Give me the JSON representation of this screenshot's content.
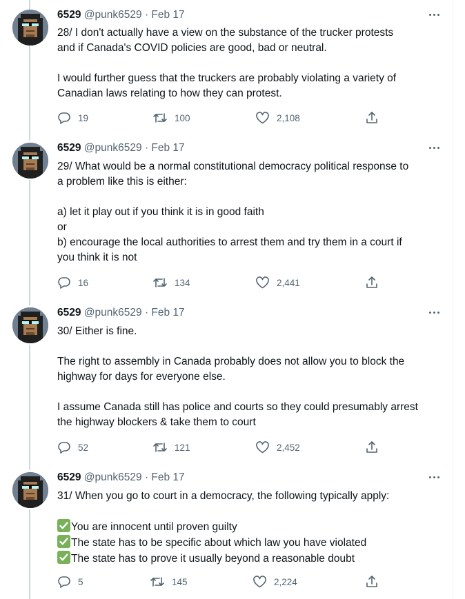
{
  "tweets": [
    {
      "author": "6529",
      "handle": "@punk6529",
      "separator": "·",
      "date": "Feb 17",
      "paragraphs": [
        [
          "28/ I don't actually have a view on the substance of the trucker protests",
          "and if Canada's COVID policies are good, bad or neutral."
        ],
        [
          "I would further guess that the truckers are probably violating a variety of",
          "Canadian laws relating to how they can protest."
        ]
      ],
      "replies": "19",
      "retweets": "100",
      "likes": "2,108"
    },
    {
      "author": "6529",
      "handle": "@punk6529",
      "separator": "·",
      "date": "Feb 17",
      "paragraphs": [
        [
          "29/ What would be a normal constitutional democracy political response to",
          "a problem like this is either:"
        ],
        [
          "a) let it play out if you think it is in good faith",
          "or",
          "b) encourage the local authorities to arrest them and try them in a court if",
          "you think it is not"
        ]
      ],
      "replies": "16",
      "retweets": "134",
      "likes": "2,441"
    },
    {
      "author": "6529",
      "handle": "@punk6529",
      "separator": "·",
      "date": "Feb 17",
      "paragraphs": [
        [
          "30/ Either is fine."
        ],
        [
          "The right to assembly in Canada probably does not allow you to block the",
          "highway for days for everyone else."
        ],
        [
          "I assume Canada still has police and courts so they could presumably arrest",
          "the highway blockers & take them to court"
        ]
      ],
      "replies": "52",
      "retweets": "121",
      "likes": "2,452"
    },
    {
      "author": "6529",
      "handle": "@punk6529",
      "separator": "·",
      "date": "Feb 17",
      "paragraphs": [
        [
          "31/ When you go to court in a democracy, the following typically apply:"
        ]
      ],
      "checklist": [
        "You are innocent until proven guilty",
        "The state has to be specific about which law you have violated",
        "The state has to prove it usually beyond a reasonable doubt"
      ],
      "replies": "5",
      "retweets": "145",
      "likes": "2,224"
    }
  ],
  "icons": {
    "reply": "reply-icon",
    "retweet": "retweet-icon",
    "like": "heart-icon",
    "share": "share-icon",
    "more": "more-icon",
    "checkmark": "check-mark-icon"
  },
  "colors": {
    "text": "#0f1419",
    "muted": "#536471",
    "thread_line": "#cfd9de",
    "check_green": "#78b159"
  }
}
